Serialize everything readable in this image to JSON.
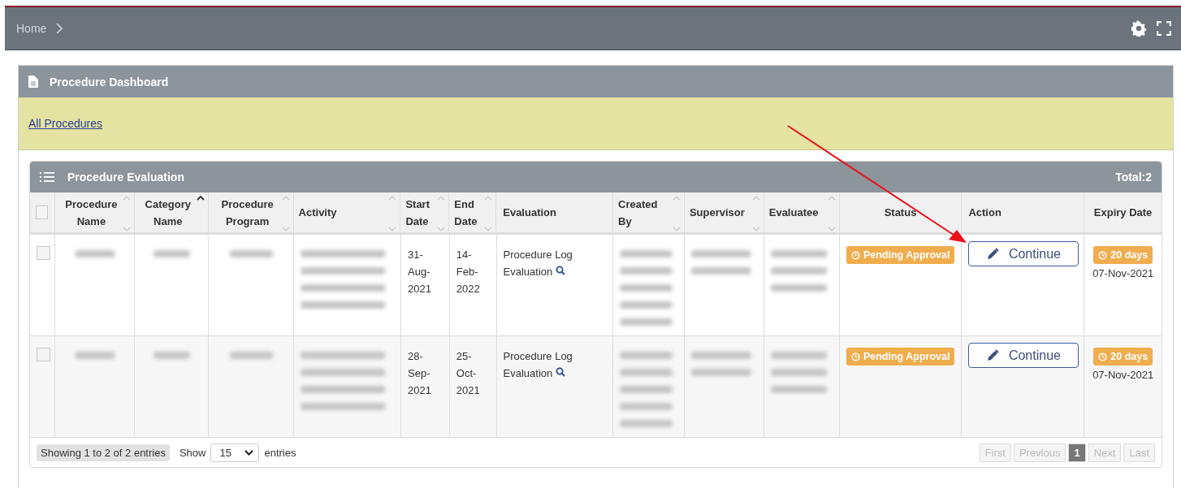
{
  "breadcrumb": {
    "items": [
      "Home"
    ]
  },
  "dashboard": {
    "title": "Procedure Dashboard",
    "link": "All Procedures"
  },
  "panel": {
    "title": "Procedure Evaluation",
    "total": "Total:2"
  },
  "table": {
    "columns": [
      {
        "kind": "check",
        "checked": false
      },
      {
        "kind": "text",
        "label": "Procedure Name",
        "sortable": true,
        "sorted": false
      },
      {
        "kind": "text",
        "label": "Category Name",
        "sortable": true,
        "sorted": true
      },
      {
        "kind": "text",
        "label": "Procedure Program",
        "sortable": true,
        "sorted": false
      },
      {
        "kind": "text",
        "label": "Activity",
        "sortable": true,
        "sorted": false
      },
      {
        "kind": "text",
        "label": "Start Date",
        "sortable": true,
        "sorted": false
      },
      {
        "kind": "text",
        "label": "End Date",
        "sortable": true,
        "sorted": false
      },
      {
        "kind": "text",
        "label": "Evaluation",
        "sortable": false,
        "sorted": false
      },
      {
        "kind": "text",
        "label": "Created By",
        "sortable": true,
        "sorted": false
      },
      {
        "kind": "text",
        "label": "Supervisor",
        "sortable": true,
        "sorted": false
      },
      {
        "kind": "text",
        "label": "Evaluatee",
        "sortable": true,
        "sorted": false
      },
      {
        "kind": "text",
        "label": "Status",
        "sortable": false,
        "sorted": false
      },
      {
        "kind": "text",
        "label": "Action",
        "sortable": false,
        "sorted": false
      },
      {
        "kind": "text",
        "label": "Expiry Date",
        "sortable": false,
        "sorted": false
      }
    ],
    "rows": [
      {
        "cells": [
          {
            "kind": "check",
            "checked": false
          },
          {
            "kind": "redacted"
          },
          {
            "kind": "redacted"
          },
          {
            "kind": "redacted"
          },
          {
            "kind": "redacted"
          },
          {
            "kind": "text",
            "text": "31-Aug-2021"
          },
          {
            "kind": "text",
            "text": "14-Feb-2022"
          },
          {
            "kind": "link",
            "text": "Procedure Log Evaluation"
          },
          {
            "kind": "redacted"
          },
          {
            "kind": "redacted"
          },
          {
            "kind": "redacted"
          },
          {
            "kind": "badge",
            "text": "Pending Approval"
          },
          {
            "kind": "button",
            "text": "Continue"
          },
          {
            "kind": "expiry",
            "badge": "20 days",
            "text": "07-Nov-2021"
          }
        ]
      },
      {
        "cells": [
          {
            "kind": "check",
            "checked": false
          },
          {
            "kind": "redacted"
          },
          {
            "kind": "redacted"
          },
          {
            "kind": "redacted"
          },
          {
            "kind": "redacted"
          },
          {
            "kind": "text",
            "text": "28-Sep-2021"
          },
          {
            "kind": "text",
            "text": "25-Oct-2021"
          },
          {
            "kind": "link",
            "text": "Procedure Log Evaluation"
          },
          {
            "kind": "redacted"
          },
          {
            "kind": "redacted"
          },
          {
            "kind": "redacted"
          },
          {
            "kind": "badge",
            "text": "Pending Approval"
          },
          {
            "kind": "button",
            "text": "Continue"
          },
          {
            "kind": "expiry",
            "badge": "20 days",
            "text": "07-Nov-2021"
          }
        ]
      }
    ]
  },
  "footer": {
    "info": "Showing 1 to 2 of 2 entries",
    "show_label": "Show",
    "page_size": "15",
    "entries_label": "entries",
    "pager": [
      {
        "label": "First",
        "selected": false
      },
      {
        "label": "Previous",
        "selected": false
      },
      {
        "label": "1",
        "selected": true
      },
      {
        "label": "Next",
        "selected": false
      },
      {
        "label": "Last",
        "selected": false
      }
    ]
  },
  "annotation_arrow": true
}
